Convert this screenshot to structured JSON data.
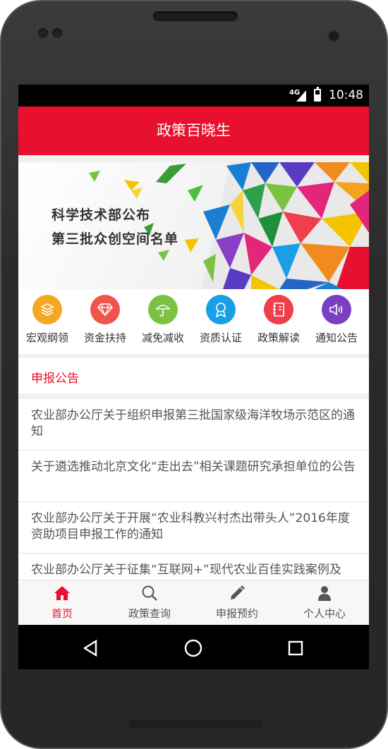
{
  "status_bar": {
    "network": "4G",
    "time": "10:48"
  },
  "app_bar": {
    "title": "政策百晓生"
  },
  "banner": {
    "line1": "科学技术部公布",
    "line2": "第三批众创空间名单"
  },
  "categories": [
    {
      "label": "宏观纲领",
      "icon": "layers-icon",
      "color": "#f5a623"
    },
    {
      "label": "资金扶持",
      "icon": "diamond-icon",
      "color": "#f0554d"
    },
    {
      "label": "减免减收",
      "icon": "umbrella-icon",
      "color": "#7cc242"
    },
    {
      "label": "资质认证",
      "icon": "award-icon",
      "color": "#1a9ee6"
    },
    {
      "label": "政策解读",
      "icon": "notebook-icon",
      "color": "#f03e4a"
    },
    {
      "label": "通知公告",
      "icon": "speaker-icon",
      "color": "#7b3fc4"
    }
  ],
  "notice": {
    "title": "申报公告",
    "items": [
      "农业部办公厅关于组织申报第三批国家级海洋牧场示范区的通知",
      "关于遴选推动北京文化“走出去”相关课题研究承担单位的公告",
      "农业部办公厅关于开展“农业科教兴村杰出带头人”2016年度资助项目申报工作的通知",
      "农业部办公厅关于征集“互联网+”现代农业百佳实践案例及"
    ]
  },
  "bottom_nav": [
    {
      "label": "首页",
      "icon": "home-icon",
      "active": true
    },
    {
      "label": "政策查询",
      "icon": "search-icon",
      "active": false
    },
    {
      "label": "申报预约",
      "icon": "pencil-icon",
      "active": false
    },
    {
      "label": "个人中心",
      "icon": "user-icon",
      "active": false
    }
  ],
  "colors": {
    "brand": "#e8102e"
  }
}
